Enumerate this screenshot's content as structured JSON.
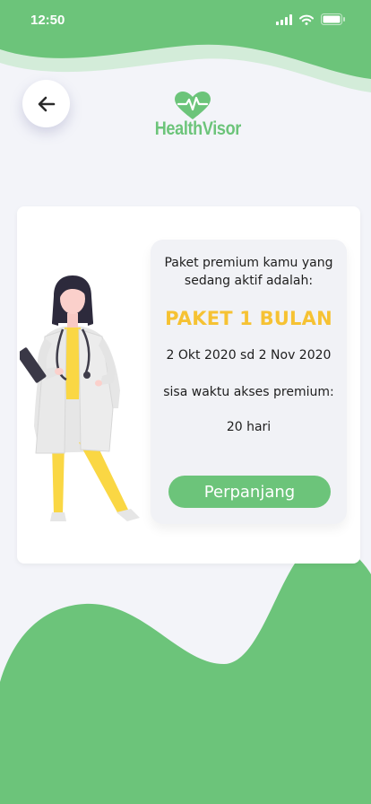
{
  "status_bar": {
    "time": "12:50",
    "icons": [
      "signal-icon",
      "wifi-icon",
      "battery-icon"
    ]
  },
  "header": {
    "back_icon": "arrow-left-icon",
    "logo_text": "HealthVisor"
  },
  "subscription": {
    "heading": "Paket premium kamu yang sedang aktif adalah:",
    "plan_name": "PAKET 1 BULAN",
    "period": "2 Okt 2020 sd 2 Nov 2020",
    "remaining_label": "sisa waktu akses premium:",
    "remaining_value": "20 hari",
    "renew_label": "Perpanjang"
  },
  "colors": {
    "brand_green": "#6cc47a",
    "light_green": "#d3ecd9",
    "accent_yellow": "#f6c233",
    "background": "#f3f4f9",
    "card": "#ffffff",
    "panel": "#f1f2f6"
  }
}
